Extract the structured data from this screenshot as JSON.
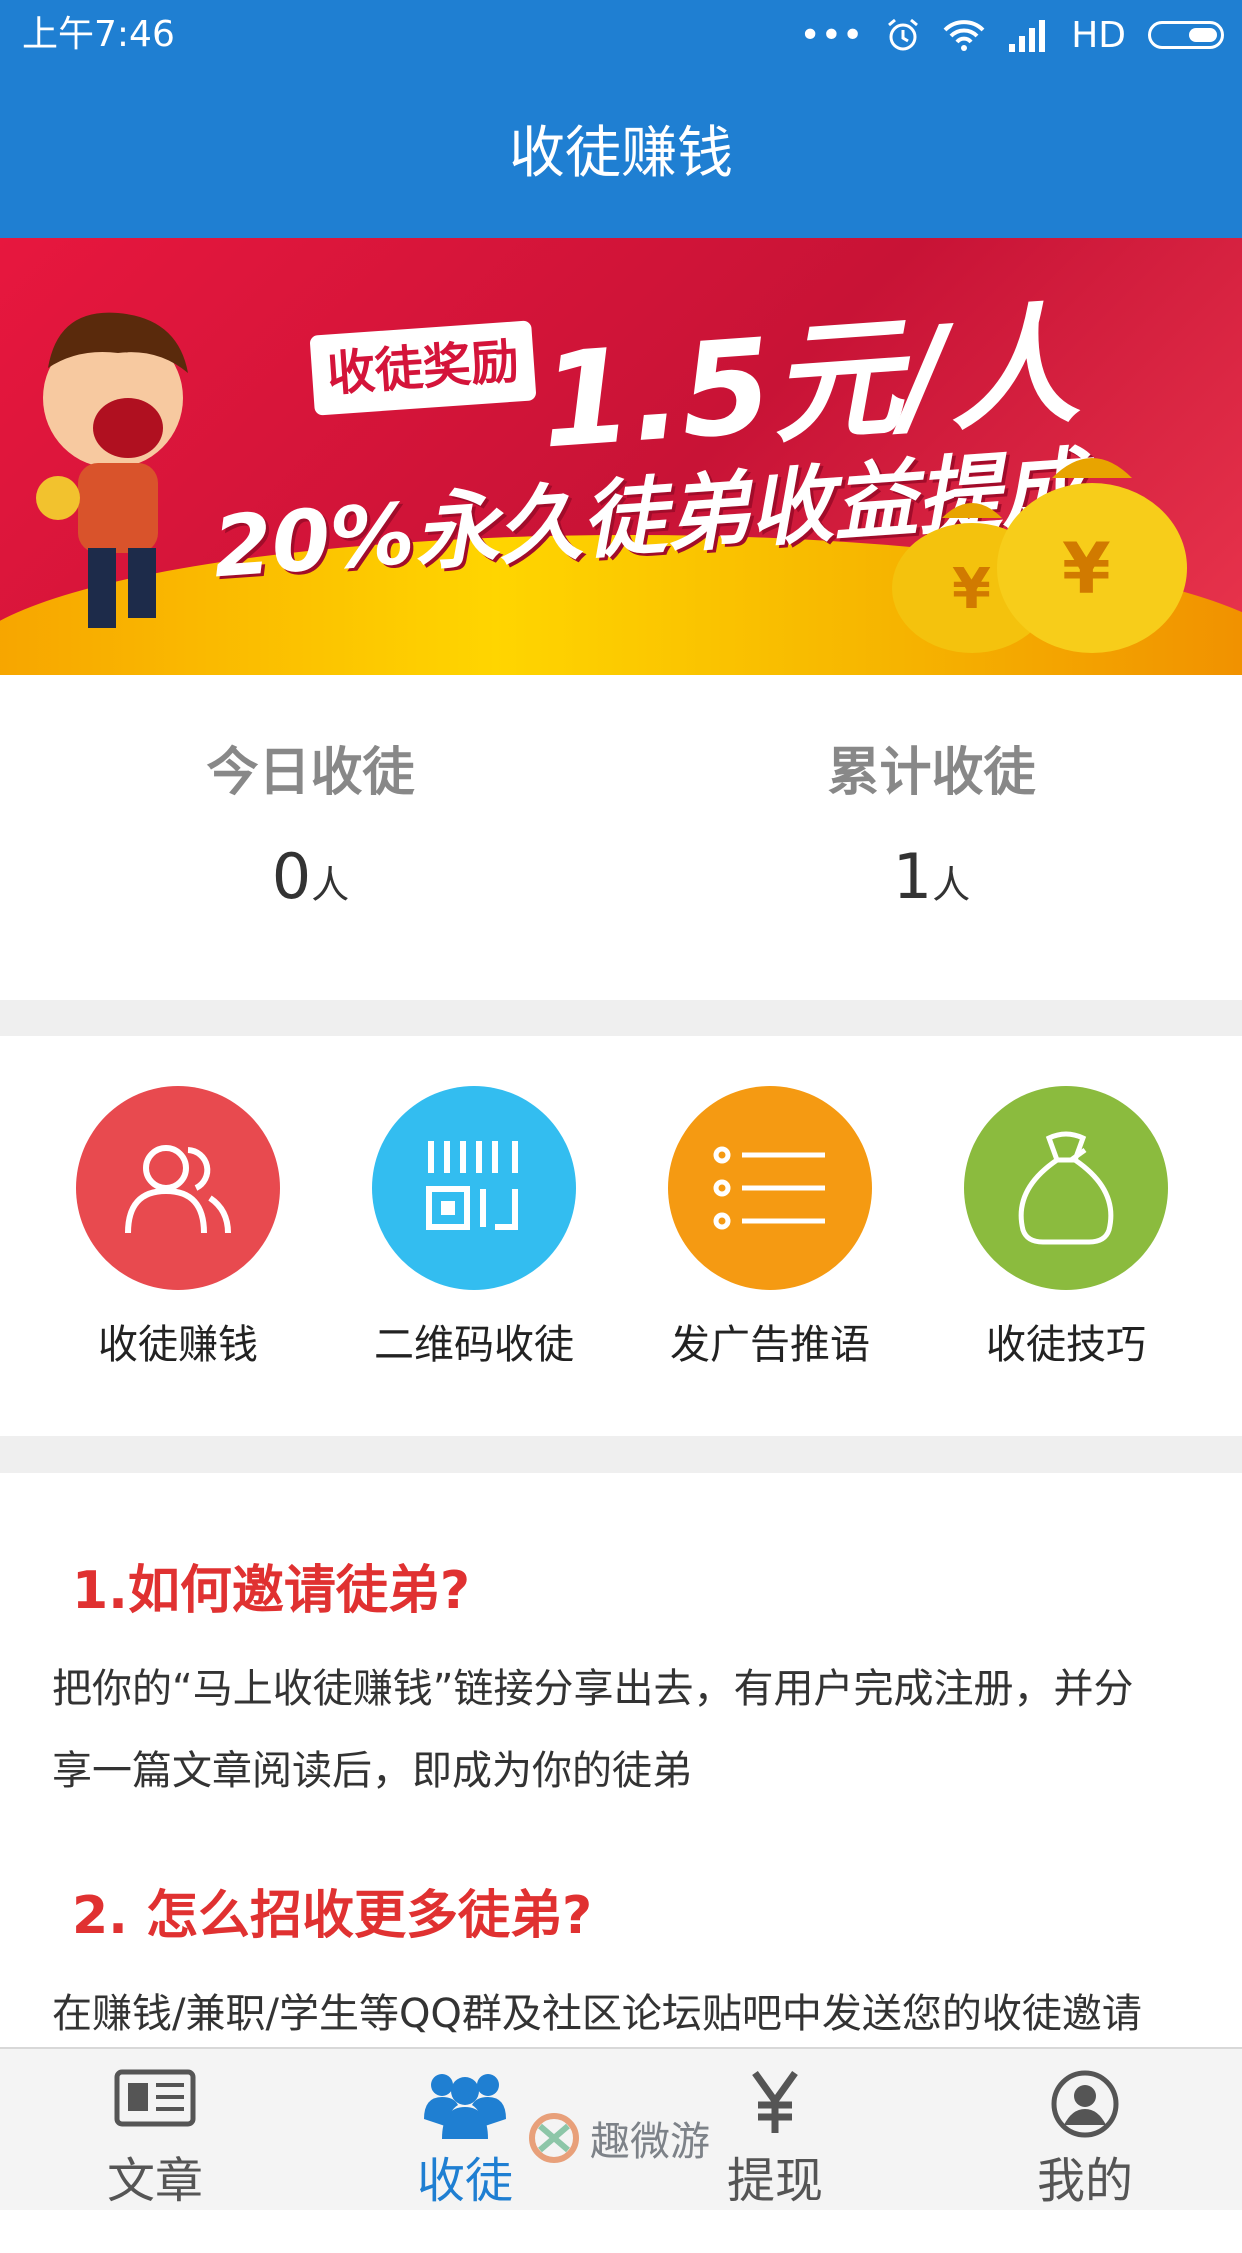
{
  "status_bar": {
    "time": "上午7:46",
    "network": "HD"
  },
  "header": {
    "title": "收徒赚钱"
  },
  "banner": {
    "tag": "收徒奖励",
    "rate": "1.5元/人",
    "headline": "20%永久徒弟收益提成"
  },
  "stats": [
    {
      "label": "今日收徒",
      "value": "0",
      "unit": "人"
    },
    {
      "label": "累计收徒",
      "value": "1",
      "unit": "人"
    }
  ],
  "features": [
    {
      "label": "收徒赚钱",
      "icon": "people-icon",
      "color": "#e84a4f"
    },
    {
      "label": "二维码收徒",
      "icon": "qr-code-icon",
      "color": "#33bdf0"
    },
    {
      "label": "发广告推语",
      "icon": "list-icon",
      "color": "#f59a12"
    },
    {
      "label": "收徒技巧",
      "icon": "money-bag-icon",
      "color": "#8bbb3e"
    }
  ],
  "article": {
    "q1_title": "1.如何邀请徒弟?",
    "q1_line1": "把你的“马上收徒赚钱”链接分享出去，有用户完成注册，并分",
    "q1_line2": "享一篇文章阅读后，即成为你的徒弟",
    "q2_title": "2. 怎么招收更多徒弟?",
    "q2_line1": "在赚钱/兼职/学生等QQ群及社区论坛贴吧中发送您的收徒邀请"
  },
  "tabbar": [
    {
      "label": "文章",
      "icon": "newspaper-icon"
    },
    {
      "label": "收徒",
      "icon": "group-icon",
      "active": true
    },
    {
      "label": "提现",
      "icon": "yen-icon"
    },
    {
      "label": "我的",
      "icon": "profile-icon"
    }
  ],
  "watermark": {
    "text": "趣微游"
  },
  "colors": {
    "primary": "#1f7fd2",
    "accent_red": "#e03131"
  }
}
